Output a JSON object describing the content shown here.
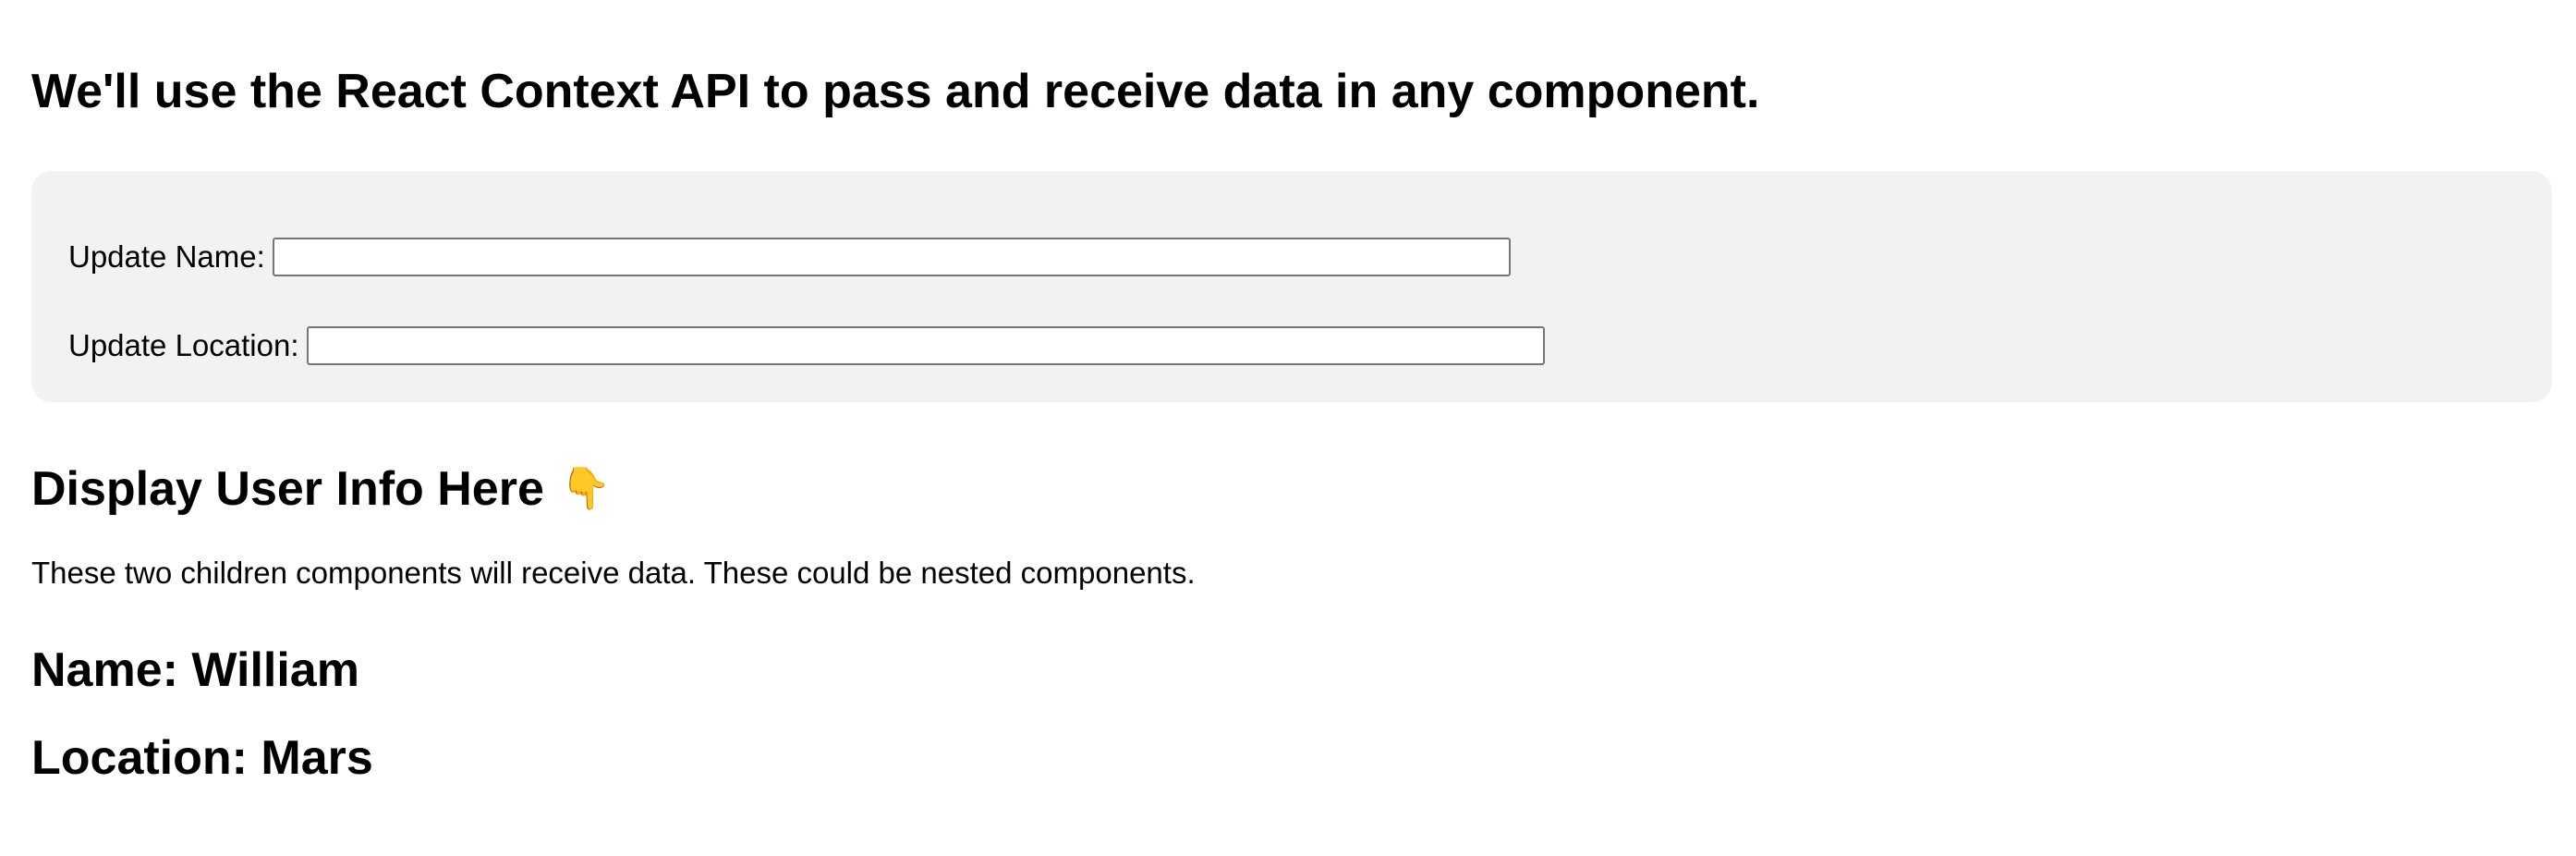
{
  "header": {
    "title": "We'll use the React Context API to pass and receive data in any component."
  },
  "form": {
    "name_label": "Update Name:",
    "name_value": "",
    "location_label": "Update Location:",
    "location_value": ""
  },
  "display": {
    "title": "Display User Info Here",
    "title_icon": "👇",
    "title_icon_name": "pointing-down-hand-icon",
    "description": "These two children components will receive data. These could be nested components.",
    "name_line": "Name: William",
    "location_line": "Location: Mars"
  },
  "colors": {
    "panel_background": "#f2f2f2",
    "text": "#000000",
    "input_border": "#767676"
  }
}
